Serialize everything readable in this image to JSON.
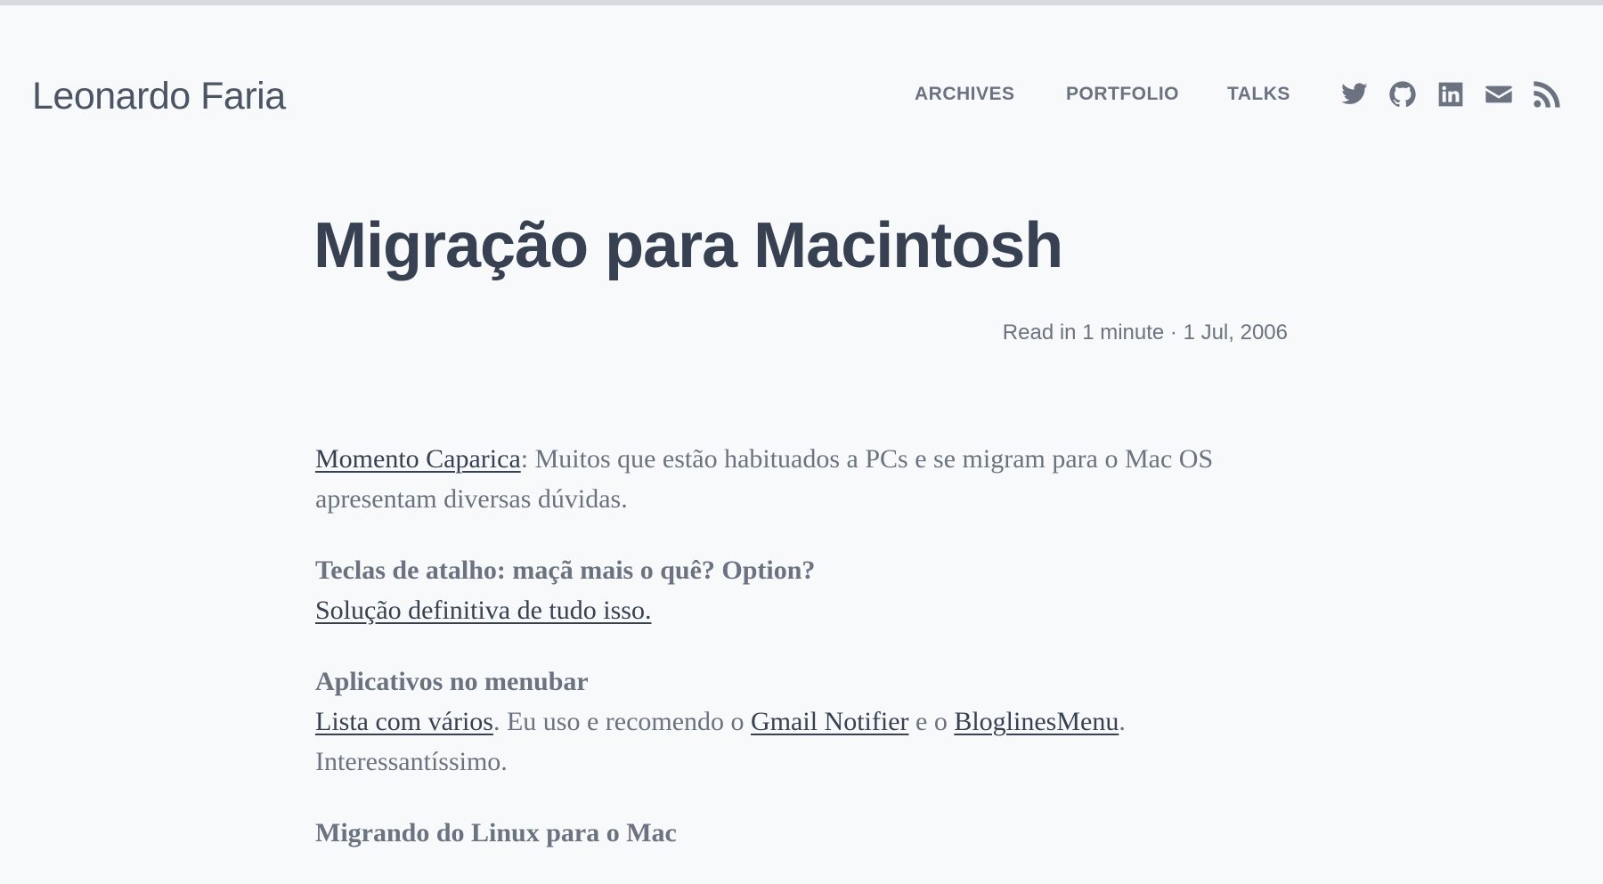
{
  "header": {
    "site_title": "Leonardo Faria",
    "nav": {
      "archives": "ARCHIVES",
      "portfolio": "PORTFOLIO",
      "talks": "TALKS"
    },
    "social_icons": [
      "twitter-icon",
      "github-icon",
      "linkedin-icon",
      "mail-icon",
      "rss-icon"
    ]
  },
  "post": {
    "title": "Migração para Macintosh",
    "meta": "Read in 1 minute · 1 Jul, 2006",
    "p1": {
      "link": "Momento Caparica",
      "text": ": Muitos que estão habituados a PCs e se migram para o Mac OS apresentam diversas dúvidas."
    },
    "p2": {
      "heading": "Teclas de atalho: maçã mais o quê? Option?",
      "link": "Solução definitiva de tudo isso."
    },
    "p3": {
      "heading": "Aplicativos no menubar",
      "link1": "Lista com vários",
      "text1": ". Eu uso e recomendo o ",
      "link2": "Gmail Notifier",
      "text2": " e o ",
      "link3": "BloglinesMenu",
      "text3": ". Interessantíssimo."
    },
    "p4": {
      "heading": "Migrando do Linux para o Mac"
    }
  },
  "colors": {
    "background": "#f8f9fb",
    "heading": "#374151",
    "text": "#6b7280",
    "top_bar": "#d7d9e0"
  }
}
